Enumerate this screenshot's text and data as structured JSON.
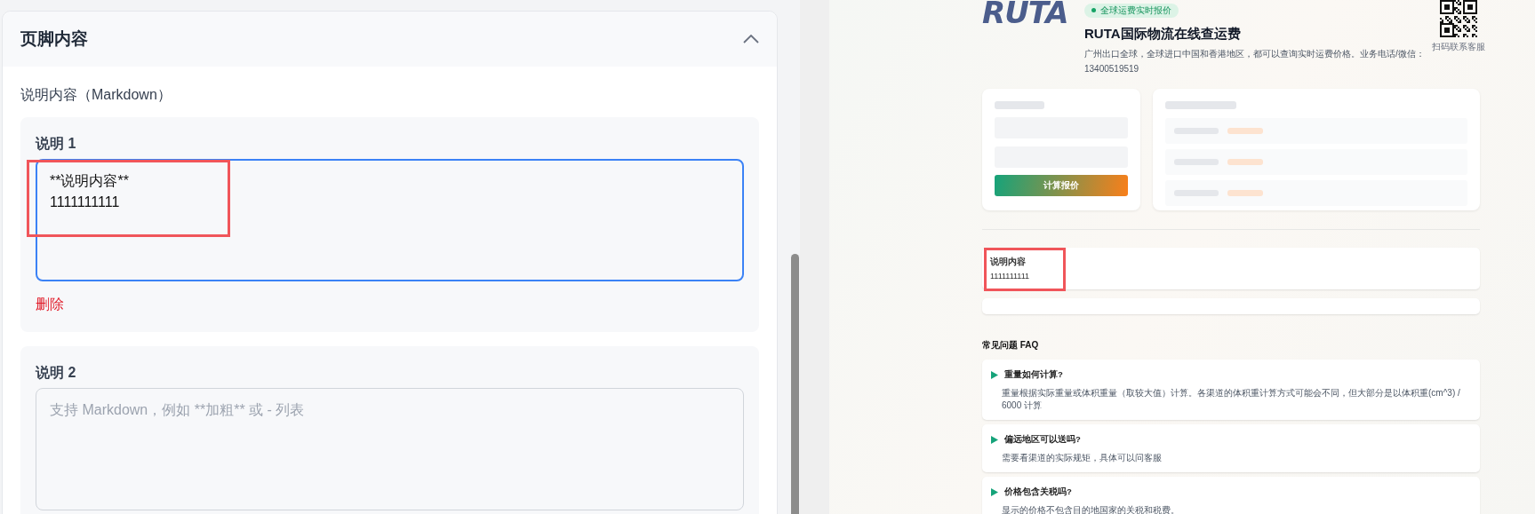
{
  "editor": {
    "section_title": "页脚内容",
    "expanded": true,
    "field_label": "说明内容（Markdown）",
    "items": [
      {
        "label": "说明 1",
        "value": "**说明内容**\n1111111111",
        "focused": true,
        "highlighted": true,
        "delete_label": "删除"
      },
      {
        "label": "说明 2",
        "placeholder": "支持 Markdown，例如 **加粗** 或 - 列表",
        "focused": false,
        "highlighted": false
      }
    ]
  },
  "preview": {
    "logo": "RUTA",
    "badge": "全球运费实时报价",
    "title": "RUTA国际物流在线查运费",
    "description": "广州出口全球，全球进口中国和香港地区，都可以查询实时运费价格。业务电话/微信：13400519519",
    "qr_caption": "扫码联系客服",
    "calc_button": "计算报价",
    "notes": [
      {
        "title": "说明内容",
        "body": "1111111111",
        "highlighted": true
      }
    ],
    "faq_title": "常见问题 FAQ",
    "faq": [
      {
        "question": "重量如何计算?",
        "answer": "重量根据实际重量或体积重量（取较大值）计算。各渠道的体积重计算方式可能会不同，但大部分是以体积重(cm^3) / 6000 计算"
      },
      {
        "question": "偏远地区可以送吗?",
        "answer": "需要看渠道的实际规矩，具体可以问客服"
      },
      {
        "question": "价格包含关税吗?",
        "answer": "显示的价格不包含目的地国家的关税和税费。"
      }
    ]
  }
}
